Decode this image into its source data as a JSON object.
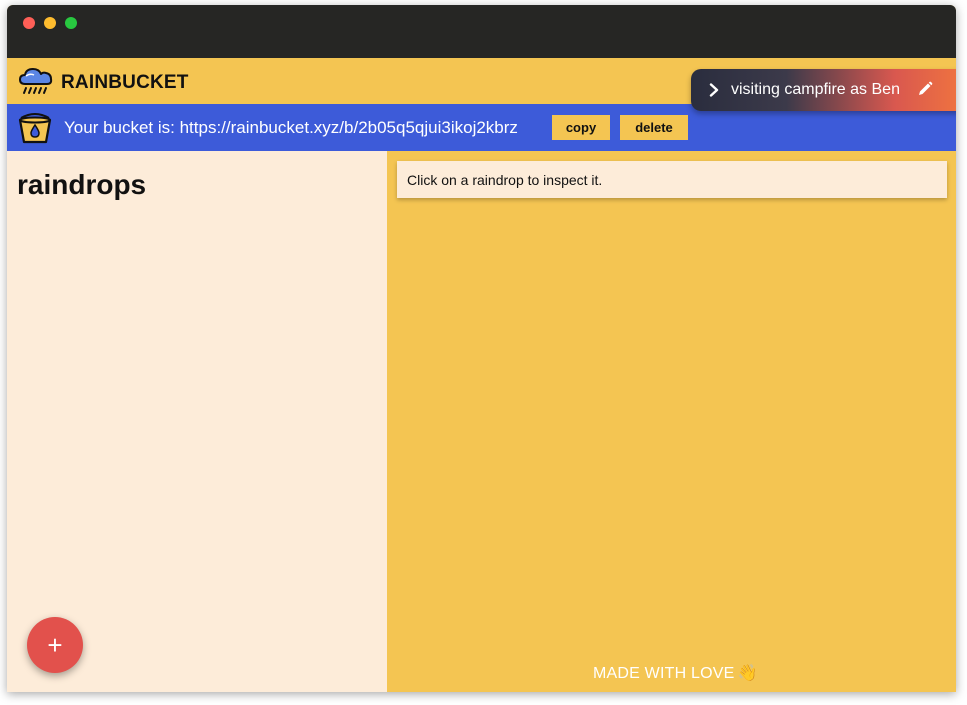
{
  "window": {
    "controls": [
      "close",
      "minimize",
      "maximize"
    ]
  },
  "app": {
    "title": "RAINBUCKET",
    "logo_icon": "rain-cloud-icon"
  },
  "visitor": {
    "text": "visiting campfire as Ben",
    "chevron_icon": "chevron-right-icon",
    "edit_icon": "pencil-icon"
  },
  "bucket": {
    "icon": "bucket-icon",
    "text": "Your bucket is: https://rainbucket.xyz/b/2b05q5qjui3ikoj2kbrz",
    "copy_label": "copy",
    "delete_label": "delete"
  },
  "left": {
    "heading": "raindrops",
    "add_label": "+"
  },
  "right": {
    "hint": "Click on a raindrop to inspect it."
  },
  "footer": {
    "text": "MADE WITH LOVE",
    "emoji": "👋"
  },
  "colors": {
    "yellow": "#f4c552",
    "blue": "#3d5bd9",
    "cream": "#fdecd9",
    "red": "#e2514c",
    "titlebar": "#262624"
  }
}
